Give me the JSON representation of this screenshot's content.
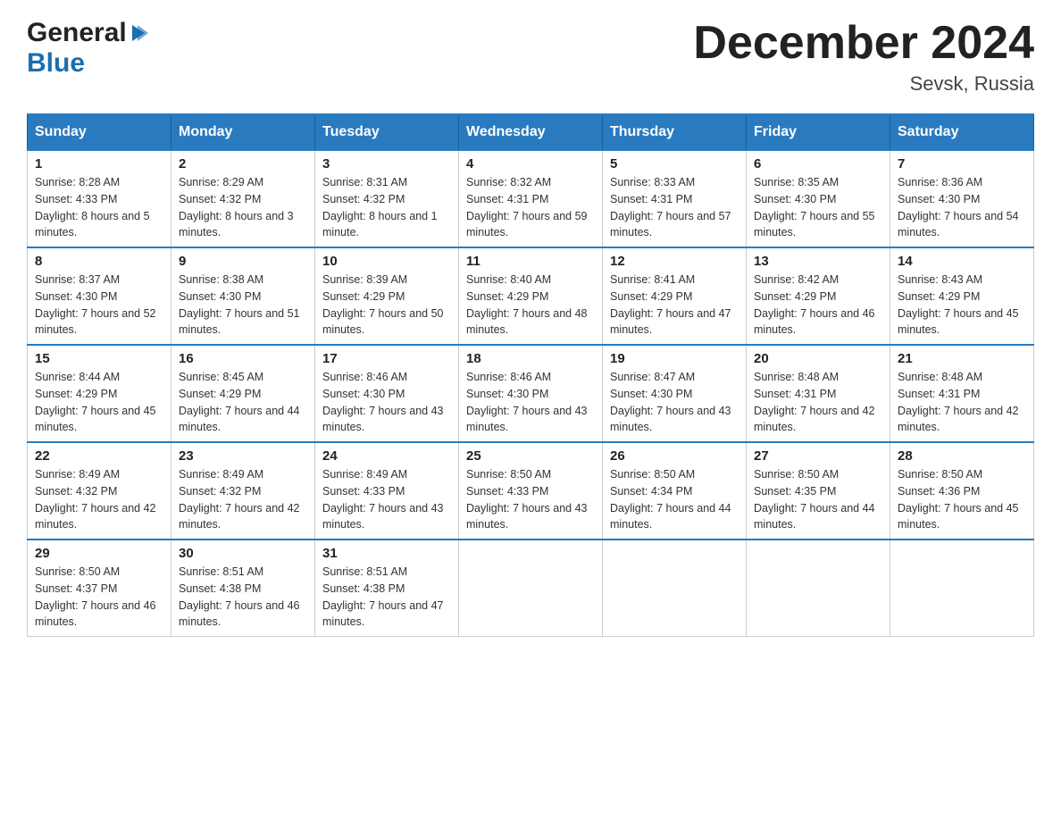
{
  "header": {
    "title": "December 2024",
    "location": "Sevsk, Russia",
    "logo_general": "General",
    "logo_blue": "Blue"
  },
  "columns": [
    "Sunday",
    "Monday",
    "Tuesday",
    "Wednesday",
    "Thursday",
    "Friday",
    "Saturday"
  ],
  "weeks": [
    [
      {
        "day": "1",
        "sunrise": "8:28 AM",
        "sunset": "4:33 PM",
        "daylight": "8 hours and 5 minutes."
      },
      {
        "day": "2",
        "sunrise": "8:29 AM",
        "sunset": "4:32 PM",
        "daylight": "8 hours and 3 minutes."
      },
      {
        "day": "3",
        "sunrise": "8:31 AM",
        "sunset": "4:32 PM",
        "daylight": "8 hours and 1 minute."
      },
      {
        "day": "4",
        "sunrise": "8:32 AM",
        "sunset": "4:31 PM",
        "daylight": "7 hours and 59 minutes."
      },
      {
        "day": "5",
        "sunrise": "8:33 AM",
        "sunset": "4:31 PM",
        "daylight": "7 hours and 57 minutes."
      },
      {
        "day": "6",
        "sunrise": "8:35 AM",
        "sunset": "4:30 PM",
        "daylight": "7 hours and 55 minutes."
      },
      {
        "day": "7",
        "sunrise": "8:36 AM",
        "sunset": "4:30 PM",
        "daylight": "7 hours and 54 minutes."
      }
    ],
    [
      {
        "day": "8",
        "sunrise": "8:37 AM",
        "sunset": "4:30 PM",
        "daylight": "7 hours and 52 minutes."
      },
      {
        "day": "9",
        "sunrise": "8:38 AM",
        "sunset": "4:30 PM",
        "daylight": "7 hours and 51 minutes."
      },
      {
        "day": "10",
        "sunrise": "8:39 AM",
        "sunset": "4:29 PM",
        "daylight": "7 hours and 50 minutes."
      },
      {
        "day": "11",
        "sunrise": "8:40 AM",
        "sunset": "4:29 PM",
        "daylight": "7 hours and 48 minutes."
      },
      {
        "day": "12",
        "sunrise": "8:41 AM",
        "sunset": "4:29 PM",
        "daylight": "7 hours and 47 minutes."
      },
      {
        "day": "13",
        "sunrise": "8:42 AM",
        "sunset": "4:29 PM",
        "daylight": "7 hours and 46 minutes."
      },
      {
        "day": "14",
        "sunrise": "8:43 AM",
        "sunset": "4:29 PM",
        "daylight": "7 hours and 45 minutes."
      }
    ],
    [
      {
        "day": "15",
        "sunrise": "8:44 AM",
        "sunset": "4:29 PM",
        "daylight": "7 hours and 45 minutes."
      },
      {
        "day": "16",
        "sunrise": "8:45 AM",
        "sunset": "4:29 PM",
        "daylight": "7 hours and 44 minutes."
      },
      {
        "day": "17",
        "sunrise": "8:46 AM",
        "sunset": "4:30 PM",
        "daylight": "7 hours and 43 minutes."
      },
      {
        "day": "18",
        "sunrise": "8:46 AM",
        "sunset": "4:30 PM",
        "daylight": "7 hours and 43 minutes."
      },
      {
        "day": "19",
        "sunrise": "8:47 AM",
        "sunset": "4:30 PM",
        "daylight": "7 hours and 43 minutes."
      },
      {
        "day": "20",
        "sunrise": "8:48 AM",
        "sunset": "4:31 PM",
        "daylight": "7 hours and 42 minutes."
      },
      {
        "day": "21",
        "sunrise": "8:48 AM",
        "sunset": "4:31 PM",
        "daylight": "7 hours and 42 minutes."
      }
    ],
    [
      {
        "day": "22",
        "sunrise": "8:49 AM",
        "sunset": "4:32 PM",
        "daylight": "7 hours and 42 minutes."
      },
      {
        "day": "23",
        "sunrise": "8:49 AM",
        "sunset": "4:32 PM",
        "daylight": "7 hours and 42 minutes."
      },
      {
        "day": "24",
        "sunrise": "8:49 AM",
        "sunset": "4:33 PM",
        "daylight": "7 hours and 43 minutes."
      },
      {
        "day": "25",
        "sunrise": "8:50 AM",
        "sunset": "4:33 PM",
        "daylight": "7 hours and 43 minutes."
      },
      {
        "day": "26",
        "sunrise": "8:50 AM",
        "sunset": "4:34 PM",
        "daylight": "7 hours and 44 minutes."
      },
      {
        "day": "27",
        "sunrise": "8:50 AM",
        "sunset": "4:35 PM",
        "daylight": "7 hours and 44 minutes."
      },
      {
        "day": "28",
        "sunrise": "8:50 AM",
        "sunset": "4:36 PM",
        "daylight": "7 hours and 45 minutes."
      }
    ],
    [
      {
        "day": "29",
        "sunrise": "8:50 AM",
        "sunset": "4:37 PM",
        "daylight": "7 hours and 46 minutes."
      },
      {
        "day": "30",
        "sunrise": "8:51 AM",
        "sunset": "4:38 PM",
        "daylight": "7 hours and 46 minutes."
      },
      {
        "day": "31",
        "sunrise": "8:51 AM",
        "sunset": "4:38 PM",
        "daylight": "7 hours and 47 minutes."
      },
      null,
      null,
      null,
      null
    ]
  ],
  "labels": {
    "sunrise": "Sunrise:",
    "sunset": "Sunset:",
    "daylight": "Daylight:"
  }
}
